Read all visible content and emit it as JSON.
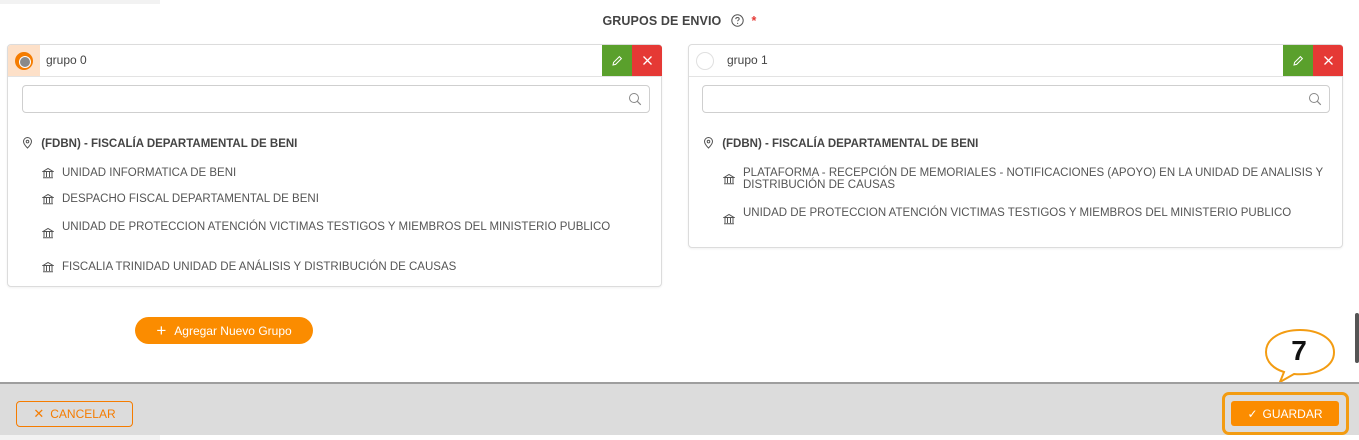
{
  "section": {
    "title": "GRUPOS DE ENVIO",
    "required_mark": "*"
  },
  "groups": [
    {
      "name": "grupo 0",
      "selected": true,
      "search_placeholder": "",
      "region": "(FDBN) - FISCALÍA DEPARTAMENTAL DE BENI",
      "units": [
        "UNIDAD INFORMATICA DE BENI",
        "DESPACHO FISCAL DEPARTAMENTAL DE BENI",
        "UNIDAD DE PROTECCION ATENCIÓN VICTIMAS TESTIGOS Y MIEMBROS DEL MINISTERIO PUBLICO",
        "FISCALIA TRINIDAD UNIDAD DE ANÁLISIS Y DISTRIBUCIÓN DE CAUSAS"
      ]
    },
    {
      "name": "grupo 1",
      "selected": false,
      "search_placeholder": "",
      "region": "(FDBN) - FISCALÍA DEPARTAMENTAL DE BENI",
      "units": [
        "PLATAFORMA - RECEPCIÓN DE MEMORIALES - NOTIFICACIONES (APOYO) EN LA UNIDAD DE ANALISIS Y DISTRIBUCIÓN DE CAUSAS",
        "UNIDAD DE PROTECCION ATENCIÓN VICTIMAS TESTIGOS Y MIEMBROS DEL MINISTERIO PUBLICO"
      ]
    }
  ],
  "actions": {
    "add_group_label": "Agregar Nuevo Grupo",
    "cancel_label": "CANCELAR",
    "save_label": "GUARDAR"
  },
  "annotation": {
    "step_number": "7"
  },
  "icons": {
    "help": "help-circle-icon",
    "pin": "map-pin-icon",
    "unit": "bank-icon",
    "edit": "pencil-icon",
    "delete": "close-icon",
    "search": "search-icon",
    "add": "plus-icon",
    "cancel": "x-icon",
    "save": "check-icon"
  },
  "colors": {
    "accent": "#fb8c00",
    "edit": "#5aa02c",
    "delete": "#e53935",
    "footer": "#dcdcdc"
  }
}
